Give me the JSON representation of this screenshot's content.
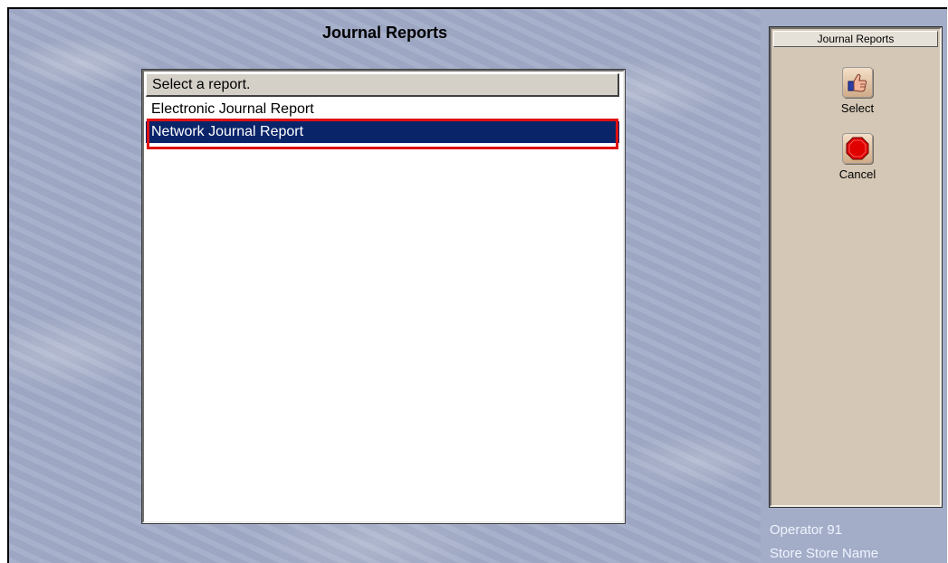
{
  "page": {
    "title": "Journal Reports"
  },
  "report_list": {
    "header": "Select a report.",
    "items": [
      "Electronic Journal Report",
      "Network Journal Report"
    ],
    "selected_index": 1
  },
  "side_panel": {
    "title": "Journal Reports",
    "buttons": [
      {
        "label": "Select",
        "icon": "thumbs-up-icon"
      },
      {
        "label": "Cancel",
        "icon": "stop-sign-icon"
      }
    ]
  },
  "status": {
    "operator": "Operator 91",
    "store": "Store Store Name"
  },
  "colors": {
    "selection": "#0a246a",
    "highlight_box": "#e01010",
    "background": "#a3adc8",
    "panel": "#d4c7b5"
  }
}
